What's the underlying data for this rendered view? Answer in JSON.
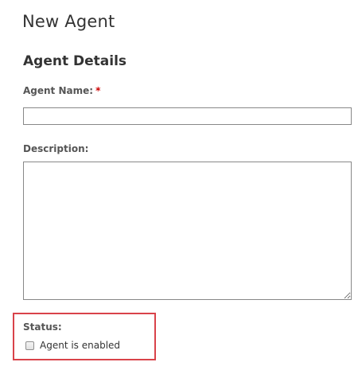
{
  "page": {
    "title": "New Agent"
  },
  "agent_details": {
    "heading": "Agent Details",
    "name_label": "Agent Name:",
    "required_marker": "*",
    "name_value": "",
    "description_label": "Description:",
    "description_value": ""
  },
  "status": {
    "label": "Status:",
    "checkbox_label": "Agent is enabled",
    "enabled": false
  },
  "colors": {
    "highlight_border": "#d9434a",
    "required_marker": "#cc0000"
  }
}
